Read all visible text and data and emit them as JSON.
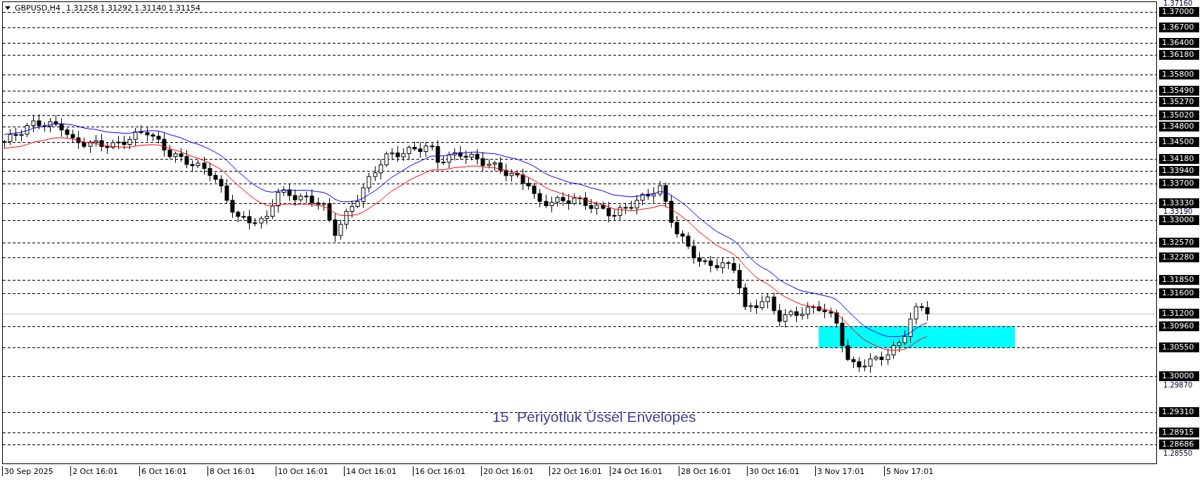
{
  "chart": {
    "symbol": "GBPUSD,H4",
    "ohlc": [
      "1.31258",
      "1.31292",
      "1.31140",
      "1.31154"
    ],
    "price_levels": [
      {
        "label": "1.37000",
        "kind": "level"
      },
      {
        "label": "1.36700",
        "kind": "level"
      },
      {
        "label": "1.36400",
        "kind": "level"
      },
      {
        "label": "1.36180",
        "kind": "level"
      },
      {
        "label": "1.35800",
        "kind": "level"
      },
      {
        "label": "1.35490",
        "kind": "level"
      },
      {
        "label": "1.35270",
        "kind": "level"
      },
      {
        "label": "1.35020",
        "kind": "level"
      },
      {
        "label": "1.34800",
        "kind": "level"
      },
      {
        "label": "1.34500",
        "kind": "level"
      },
      {
        "label": "1.34180",
        "kind": "level"
      },
      {
        "label": "1.33940",
        "kind": "level"
      },
      {
        "label": "1.33700",
        "kind": "level"
      },
      {
        "label": "1.33330",
        "kind": "level"
      },
      {
        "label": "1.33000",
        "kind": "level"
      },
      {
        "label": "1.32570",
        "kind": "level"
      },
      {
        "label": "1.32280",
        "kind": "level"
      },
      {
        "label": "1.31850",
        "kind": "level"
      },
      {
        "label": "1.31600",
        "kind": "level"
      },
      {
        "label": "1.31200",
        "kind": "price"
      },
      {
        "label": "1.30960",
        "kind": "zone_top"
      },
      {
        "label": "1.30550",
        "kind": "zone_bottom"
      },
      {
        "label": "1.30000",
        "kind": "level"
      },
      {
        "label": "1.29310",
        "kind": "level"
      },
      {
        "label": "1.28915",
        "kind": "level"
      },
      {
        "label": "1.28686",
        "kind": "level"
      }
    ],
    "scale_labels": [
      "1.37160",
      "1.33190",
      "1.29870",
      "1.28550"
    ],
    "time_labels": [
      "30 Sep 2025",
      "2 Oct 16:01",
      "6 Oct 16:01",
      "8 Oct 16:01",
      "10 Oct 16:01",
      "14 Oct 16:01",
      "16 Oct 16:01",
      "20 Oct 16:01",
      "22 Oct 16:01",
      "24 Oct 16:01",
      "28 Oct 16:01",
      "30 Oct 16:01",
      "3 Nov 17:01",
      "5 Nov 17:01"
    ],
    "caption": "15  Periyotluk Üssel Envelopes"
  }
}
